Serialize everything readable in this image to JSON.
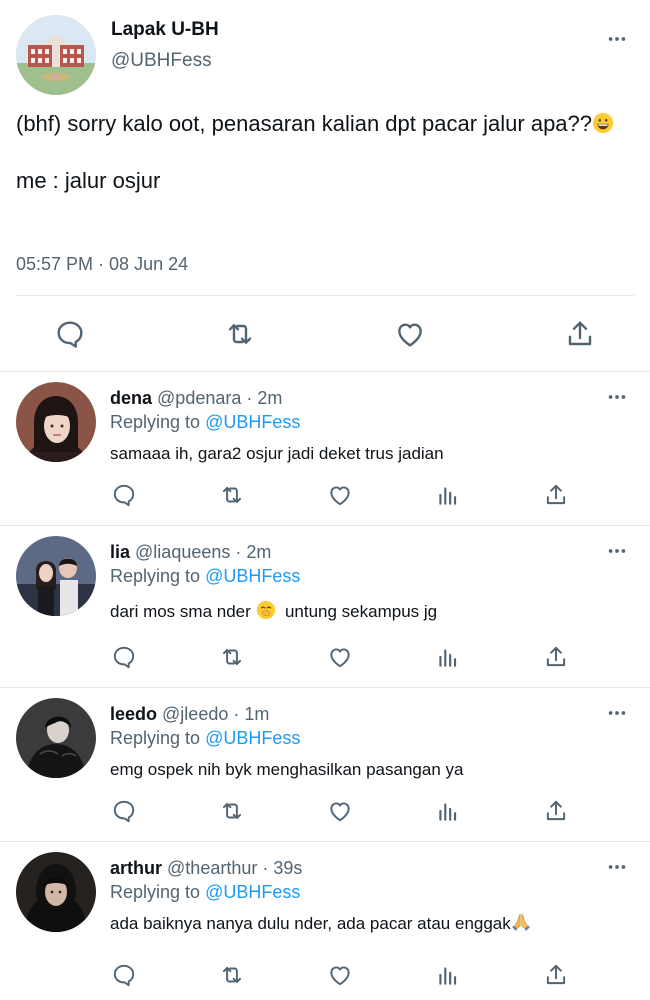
{
  "main_tweet": {
    "author_name": "Lapak U-BH",
    "author_handle": "@UBHFess",
    "text_line1": "(bhf) sorry kalo oot, penasaran kalian dpt pacar jalur apa??",
    "text_line2": "me : jalur osjur",
    "timestamp": "05:57 PM · 08 Jun 24",
    "emoji": "grinning-face-emoji"
  },
  "replies": [
    {
      "name": "dena",
      "meta": "@pdenara · 2m",
      "replying_prefix": "Replying to",
      "replying_to": "@UBHFess",
      "text": "samaaa ih, gara2 osjur jadi deket trus jadian"
    },
    {
      "name": "lia",
      "meta": "@liaqueens · 2m",
      "replying_prefix": "Replying to",
      "replying_to": "@UBHFess",
      "text_before_emoji": "dari mos sma nder ",
      "emoji": "hand-over-mouth-emoji",
      "text_after_emoji": "  untung sekampus jg"
    },
    {
      "name": "leedo",
      "meta": "@jleedo · 1m",
      "replying_prefix": "Replying to",
      "replying_to": "@UBHFess",
      "text": "emg ospek nih byk menghasilkan pasangan ya"
    },
    {
      "name": "arthur",
      "meta": "@thearthur · 39s",
      "replying_prefix": "Replying to",
      "replying_to": "@UBHFess",
      "text": "ada baiknya nanya dulu nder, ada pacar atau enggak",
      "emoji": "folded-hands-emoji"
    }
  ],
  "icons": {
    "reply": "reply-icon",
    "retweet": "retweet-icon",
    "like": "heart-icon",
    "views": "views-icon",
    "share": "share-icon",
    "more": "more-icon"
  },
  "colors": {
    "text": "#0f1419",
    "secondary": "#536471",
    "link": "#1d9bf0",
    "divider": "#e6e9ec"
  }
}
